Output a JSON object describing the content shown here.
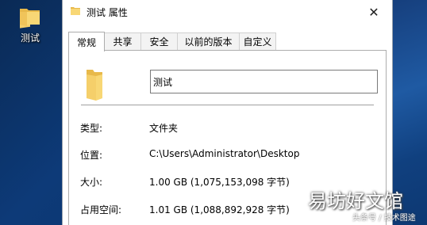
{
  "desktop": {
    "icon_label": "测试"
  },
  "window": {
    "title": "测试 属性",
    "close_glyph": "✕",
    "tabs": [
      "常规",
      "共享",
      "安全",
      "以前的版本",
      "自定义"
    ],
    "active_tab": "常规",
    "name_value": "测试",
    "props": [
      {
        "key": "类型:",
        "value": "文件夹"
      },
      {
        "key": "位置:",
        "value": "C:\\Users\\Administrator\\Desktop"
      },
      {
        "key": "大小:",
        "value": "1.00 GB (1,075,153,098 字节)"
      },
      {
        "key": "占用空间:",
        "value": "1.01 GB (1,088,892,928 字节)"
      }
    ]
  },
  "watermark": {
    "main": "易坊好文馆",
    "sub": "头条号 / 技术图途"
  },
  "colors": {
    "folder_yellow": "#f8d775",
    "folder_dark": "#e8b94a",
    "desktop_blue": "#0d3a78"
  },
  "icons": [
    "folder-icon",
    "close-icon"
  ]
}
